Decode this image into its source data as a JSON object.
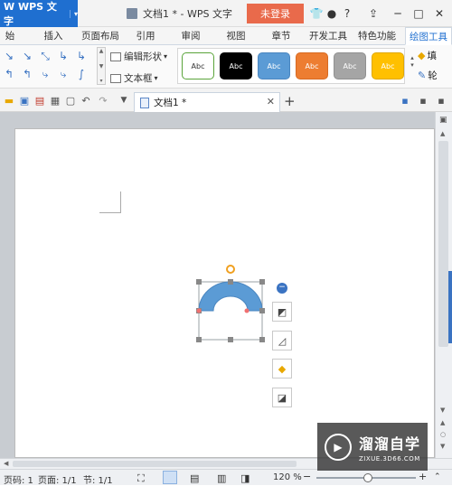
{
  "app": {
    "menu_label": "W WPS 文字",
    "menu_arrow": "▾"
  },
  "window": {
    "title": "文档1 * - WPS 文字",
    "login_label": "未登录",
    "controls": [
      "─",
      "□",
      "✕"
    ]
  },
  "tabs": [
    {
      "label": "始"
    },
    {
      "label": "插入"
    },
    {
      "label": "页面布局"
    },
    {
      "label": "引用"
    },
    {
      "label": "审阅"
    },
    {
      "label": "视图"
    },
    {
      "label": "章节"
    },
    {
      "label": "开发工具"
    },
    {
      "label": "特色功能"
    },
    {
      "label": "绘图工具"
    }
  ],
  "ribbon": {
    "edit_shape_label": "编辑形状",
    "text_box_label": "文本框",
    "styles": [
      {
        "label": "Abc",
        "bg": "#ffffff",
        "color": "#333333",
        "border": "#5aa43a"
      },
      {
        "label": "Abc",
        "bg": "#000000",
        "color": "#ffffff",
        "border": "#000000"
      },
      {
        "label": "Abc",
        "bg": "#5b9bd5",
        "color": "#ffffff",
        "border": "#4a86c0"
      },
      {
        "label": "Abc",
        "bg": "#ed7d31",
        "color": "#ffffff",
        "border": "#d76a22"
      },
      {
        "label": "Abc",
        "bg": "#a5a5a5",
        "color": "#ffffff",
        "border": "#909090"
      },
      {
        "label": "Abc",
        "bg": "#ffc000",
        "color": "#ffffff",
        "border": "#e0a800"
      }
    ],
    "fill_label": "填",
    "outline_label": "轮"
  },
  "doc_tab": {
    "label": "文档1 *"
  },
  "status": {
    "page": "页码: 1",
    "pages": "页面: 1/1",
    "section": "节: 1/1",
    "zoom": "120 %"
  },
  "watermark": {
    "title": "溜溜自学",
    "subtitle": "ZIXUE.3D66.COM"
  },
  "colors": {
    "accent": "#1f6fd0",
    "login": "#e96a4b",
    "shape_fill": "#5b9bd5"
  }
}
